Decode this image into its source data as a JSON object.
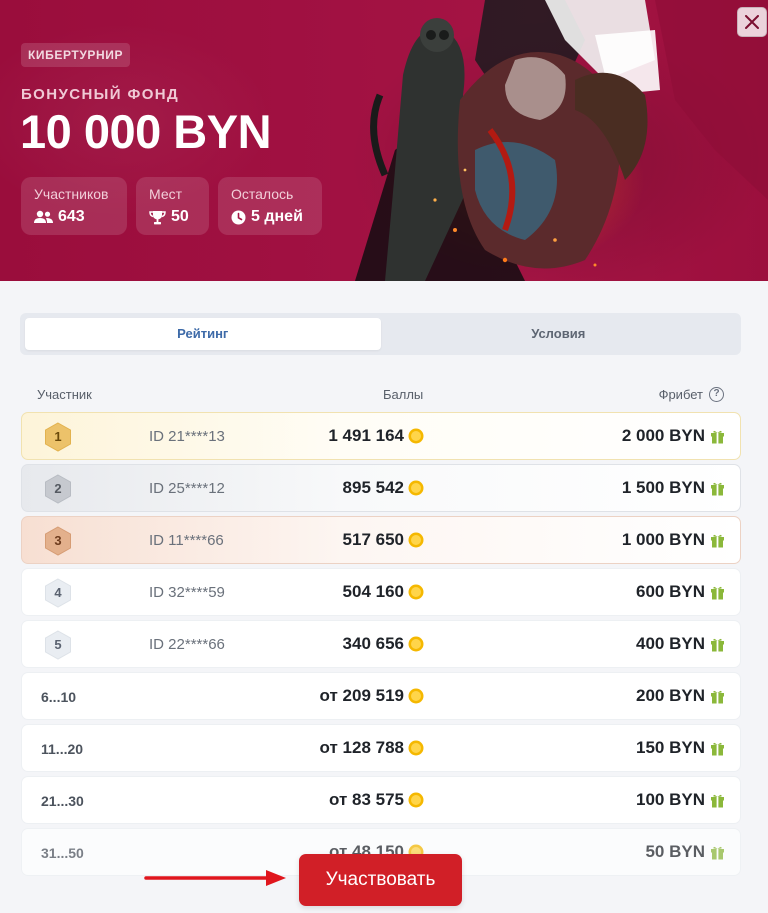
{
  "hero": {
    "tag": "КИБЕРТУРНИР",
    "fund_label": "БОНУСНЫЙ ФОНД",
    "fund_amount": "10 000 BYN",
    "stats": [
      {
        "label": "Участников",
        "value": "643",
        "icon": "users-icon"
      },
      {
        "label": "Мест",
        "value": "50",
        "icon": "trophy-icon"
      },
      {
        "label": "Осталось",
        "value": "5 дней",
        "icon": "clock-icon"
      }
    ]
  },
  "tabs": [
    {
      "label": "Рейтинг",
      "active": true
    },
    {
      "label": "Условия",
      "active": false
    }
  ],
  "table": {
    "headers": {
      "participant": "Участник",
      "points": "Баллы",
      "freebet": "Фрибет",
      "help": "?"
    },
    "rows": [
      {
        "rank": "1",
        "id": "ID 21****13",
        "points": "1 491 164",
        "freebet": "2 000 BYN"
      },
      {
        "rank": "2",
        "id": "ID 25****12",
        "points": "895 542",
        "freebet": "1 500 BYN"
      },
      {
        "rank": "3",
        "id": "ID 11****66",
        "points": "517 650",
        "freebet": "1 000 BYN"
      },
      {
        "rank": "4",
        "id": "ID 32****59",
        "points": "504 160",
        "freebet": "600 BYN"
      },
      {
        "rank": "5",
        "id": "ID 22****66",
        "points": "340 656",
        "freebet": "400 BYN"
      },
      {
        "range": "6...10",
        "points": "от 209 519",
        "freebet": "200 BYN"
      },
      {
        "range": "11...20",
        "points": "от 128 788",
        "freebet": "150 BYN"
      },
      {
        "range": "21...30",
        "points": "от 83 575",
        "freebet": "100 BYN"
      },
      {
        "range": "31...50",
        "points": "от 48 150",
        "freebet": "50 BYN"
      }
    ]
  },
  "cta": {
    "label": "Участвовать"
  },
  "colors": {
    "brand": "#a11142",
    "cta": "#d11f27",
    "tab_active": "#3d6aa8",
    "coin": "#f5b800",
    "gift": "#8bb83a"
  }
}
